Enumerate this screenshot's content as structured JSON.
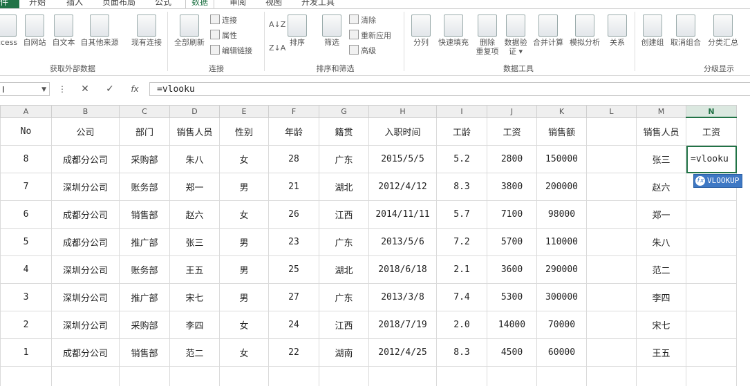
{
  "tabs": {
    "file": "件",
    "home": "开始",
    "insert": "插入",
    "layout": "页面布局",
    "formulas": "公式",
    "data": "数据",
    "review": "审阅",
    "view": "视图",
    "developer": "开发工具"
  },
  "ribbon": {
    "get_external": {
      "access": "ccess",
      "web": "自网站",
      "text": "自文本",
      "other": "自其他来源",
      "existing": "现有连接",
      "label": "获取外部数据"
    },
    "connections": {
      "refresh_all": "全部刷新",
      "connections": "连接",
      "properties": "属性",
      "edit_links": "编辑链接",
      "label": "连接"
    },
    "sort_filter": {
      "sort": "排序",
      "filter": "筛选",
      "clear": "清除",
      "reapply": "重新应用",
      "advanced": "高级",
      "label": "排序和筛选",
      "sort_az": "A↓Z",
      "sort_za": "Z↓A"
    },
    "data_tools": {
      "split": "分列",
      "flash_fill": "快速填充",
      "remove_dup": "删除\n重复项",
      "validation": "数据验\n证 ▾",
      "consolidate": "合并计算",
      "whatif": "模拟分析",
      "relationships": "关系",
      "label": "数据工具"
    },
    "outline": {
      "group": "创建组",
      "ungroup": "取消组合",
      "subtotal": "分类汇总",
      "label": "分级显示"
    }
  },
  "formula_bar": {
    "name_box": "I",
    "cancel": "✕",
    "enter": "✓",
    "fx": "fx",
    "formula": "=vlooku"
  },
  "columns": [
    "A",
    "B",
    "C",
    "D",
    "E",
    "F",
    "G",
    "H",
    "I",
    "J",
    "K",
    "L",
    "M",
    "N"
  ],
  "headers": [
    "No",
    "公司",
    "部门",
    "销售人员",
    "性别",
    "年龄",
    "籍贯",
    "入职时间",
    "工龄",
    "工资",
    "销售额",
    "",
    "销售人员",
    "工资"
  ],
  "rows": [
    [
      "8",
      "成都分公司",
      "采购部",
      "朱八",
      "女",
      "28",
      "广东",
      "2015/5/5",
      "5.2",
      "2800",
      "150000",
      "",
      "张三",
      "=vlooku"
    ],
    [
      "7",
      "深圳分公司",
      "账务部",
      "郑一",
      "男",
      "21",
      "湖北",
      "2012/4/12",
      "8.3",
      "3800",
      "200000",
      "",
      "赵六",
      ""
    ],
    [
      "6",
      "成都分公司",
      "销售部",
      "赵六",
      "女",
      "26",
      "江西",
      "2014/11/11",
      "5.7",
      "7100",
      "98000",
      "",
      "郑一",
      ""
    ],
    [
      "5",
      "成都分公司",
      "推广部",
      "张三",
      "男",
      "23",
      "广东",
      "2013/5/6",
      "7.2",
      "5700",
      "110000",
      "",
      "朱八",
      ""
    ],
    [
      "4",
      "深圳分公司",
      "账务部",
      "王五",
      "男",
      "25",
      "湖北",
      "2018/6/18",
      "2.1",
      "3600",
      "290000",
      "",
      "范二",
      ""
    ],
    [
      "3",
      "深圳分公司",
      "推广部",
      "宋七",
      "男",
      "27",
      "广东",
      "2013/3/8",
      "7.4",
      "5300",
      "300000",
      "",
      "李四",
      ""
    ],
    [
      "2",
      "深圳分公司",
      "采购部",
      "李四",
      "女",
      "24",
      "江西",
      "2018/7/19",
      "2.0",
      "14000",
      "70000",
      "",
      "宋七",
      ""
    ],
    [
      "1",
      "成都分公司",
      "销售部",
      "范二",
      "女",
      "22",
      "湖南",
      "2012/4/25",
      "8.3",
      "4500",
      "60000",
      "",
      "王五",
      ""
    ]
  ],
  "autocomplete": {
    "icon": "fx",
    "label": "VLOOKUP"
  },
  "colors": {
    "accent": "#217346",
    "autocomplete": "#3e78c4"
  }
}
